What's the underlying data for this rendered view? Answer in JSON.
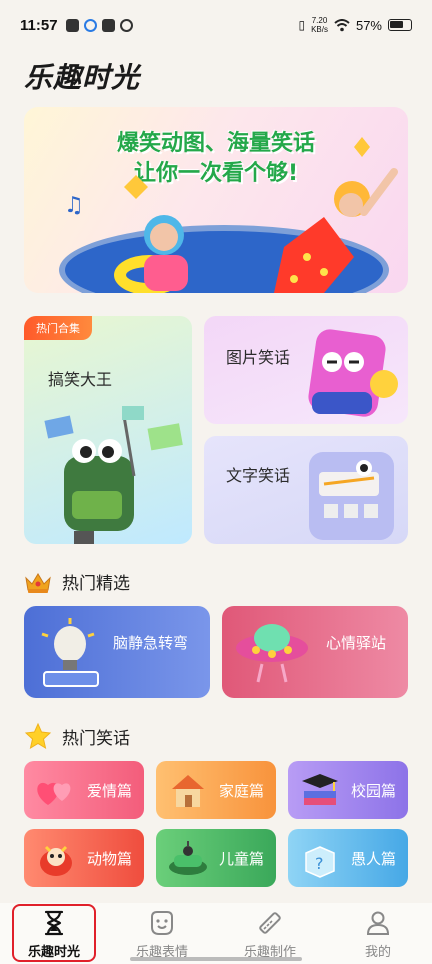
{
  "status_bar": {
    "time": "11:57",
    "net_speed_value": "7.20",
    "net_speed_unit": "KB/s",
    "battery": "57%"
  },
  "app_title": "乐趣时光",
  "banner": {
    "line1": "爆笑动图、海量笑话",
    "line2": "让你一次看个够!"
  },
  "categories": {
    "hot_tag": "热门合集",
    "funny_king": "搞笑大王",
    "picture_jokes": "图片笑话",
    "text_jokes": "文字笑话"
  },
  "hot_picks": {
    "title": "热门精选",
    "items": [
      "脑静急转弯",
      "心情驿站"
    ]
  },
  "hot_jokes": {
    "title": "热门笑话",
    "tiles": [
      "爱情篇",
      "家庭篇",
      "校园篇",
      "动物篇",
      "儿童篇",
      "愚人篇"
    ]
  },
  "bottom_nav": {
    "items": [
      "乐趣时光",
      "乐趣表情",
      "乐趣制作",
      "我的"
    ],
    "active": "乐趣时光"
  },
  "colors": {
    "accent_green": "#24a84a",
    "highlight_red": "#e0202a"
  }
}
